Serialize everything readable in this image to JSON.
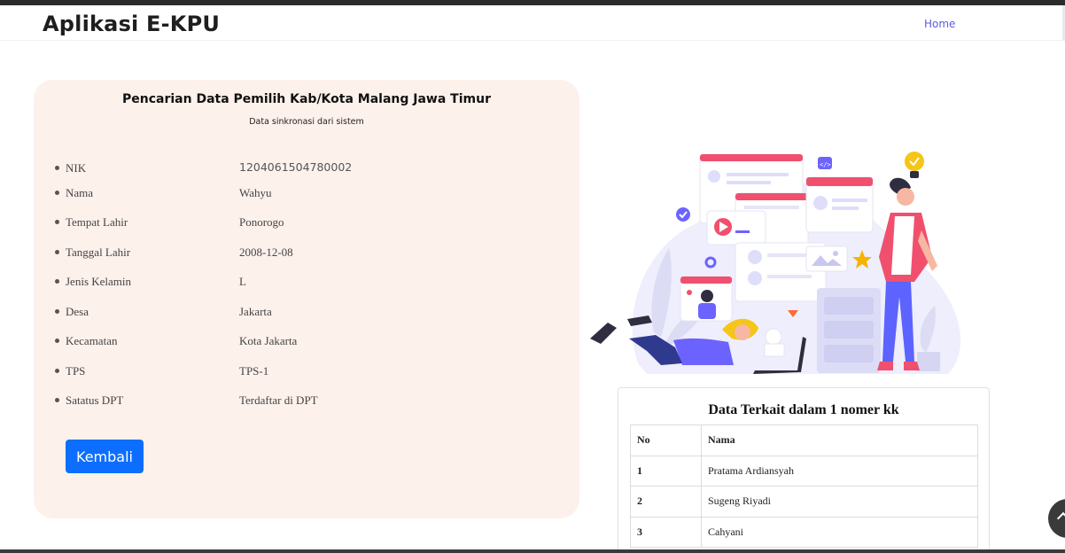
{
  "navbar": {
    "brand": "Aplikasi E-KPU",
    "home_link": "Home"
  },
  "search_card": {
    "title": "Pencarian Data Pemilih Kab/Kota Malang Jawa Timur",
    "subtitle": "Data sinkronasi dari sistem",
    "fields": [
      {
        "label": "NIK",
        "value": "1204061504780002"
      },
      {
        "label": "Nama",
        "value": "Wahyu"
      },
      {
        "label": "Tempat Lahir",
        "value": "Ponorogo"
      },
      {
        "label": "Tanggal Lahir",
        "value": "2008-12-08"
      },
      {
        "label": "Jenis Kelamin",
        "value": "L"
      },
      {
        "label": "Desa",
        "value": "Jakarta"
      },
      {
        "label": "Kecamatan",
        "value": "Kota Jakarta"
      },
      {
        "label": "TPS",
        "value": "TPS-1"
      },
      {
        "label": "Satatus DPT",
        "value": "Terdaftar di DPT"
      }
    ],
    "back_button": "Kembali"
  },
  "kk_card": {
    "title": "Data Terkait dalam 1 nomer kk",
    "headers": {
      "no": "No",
      "nama": "Nama"
    },
    "rows": [
      {
        "no": "1",
        "nama": "Pratama Ardiansyah"
      },
      {
        "no": "2",
        "nama": "Sugeng Riyadi"
      },
      {
        "no": "3",
        "nama": "Cahyani"
      }
    ]
  },
  "colors": {
    "accent": "#0d6efd",
    "nav_link": "#5b5ce0",
    "card_bg": "#fdf1ec",
    "illustration_red": "#f0506e",
    "illustration_purple": "#6c63ff"
  }
}
